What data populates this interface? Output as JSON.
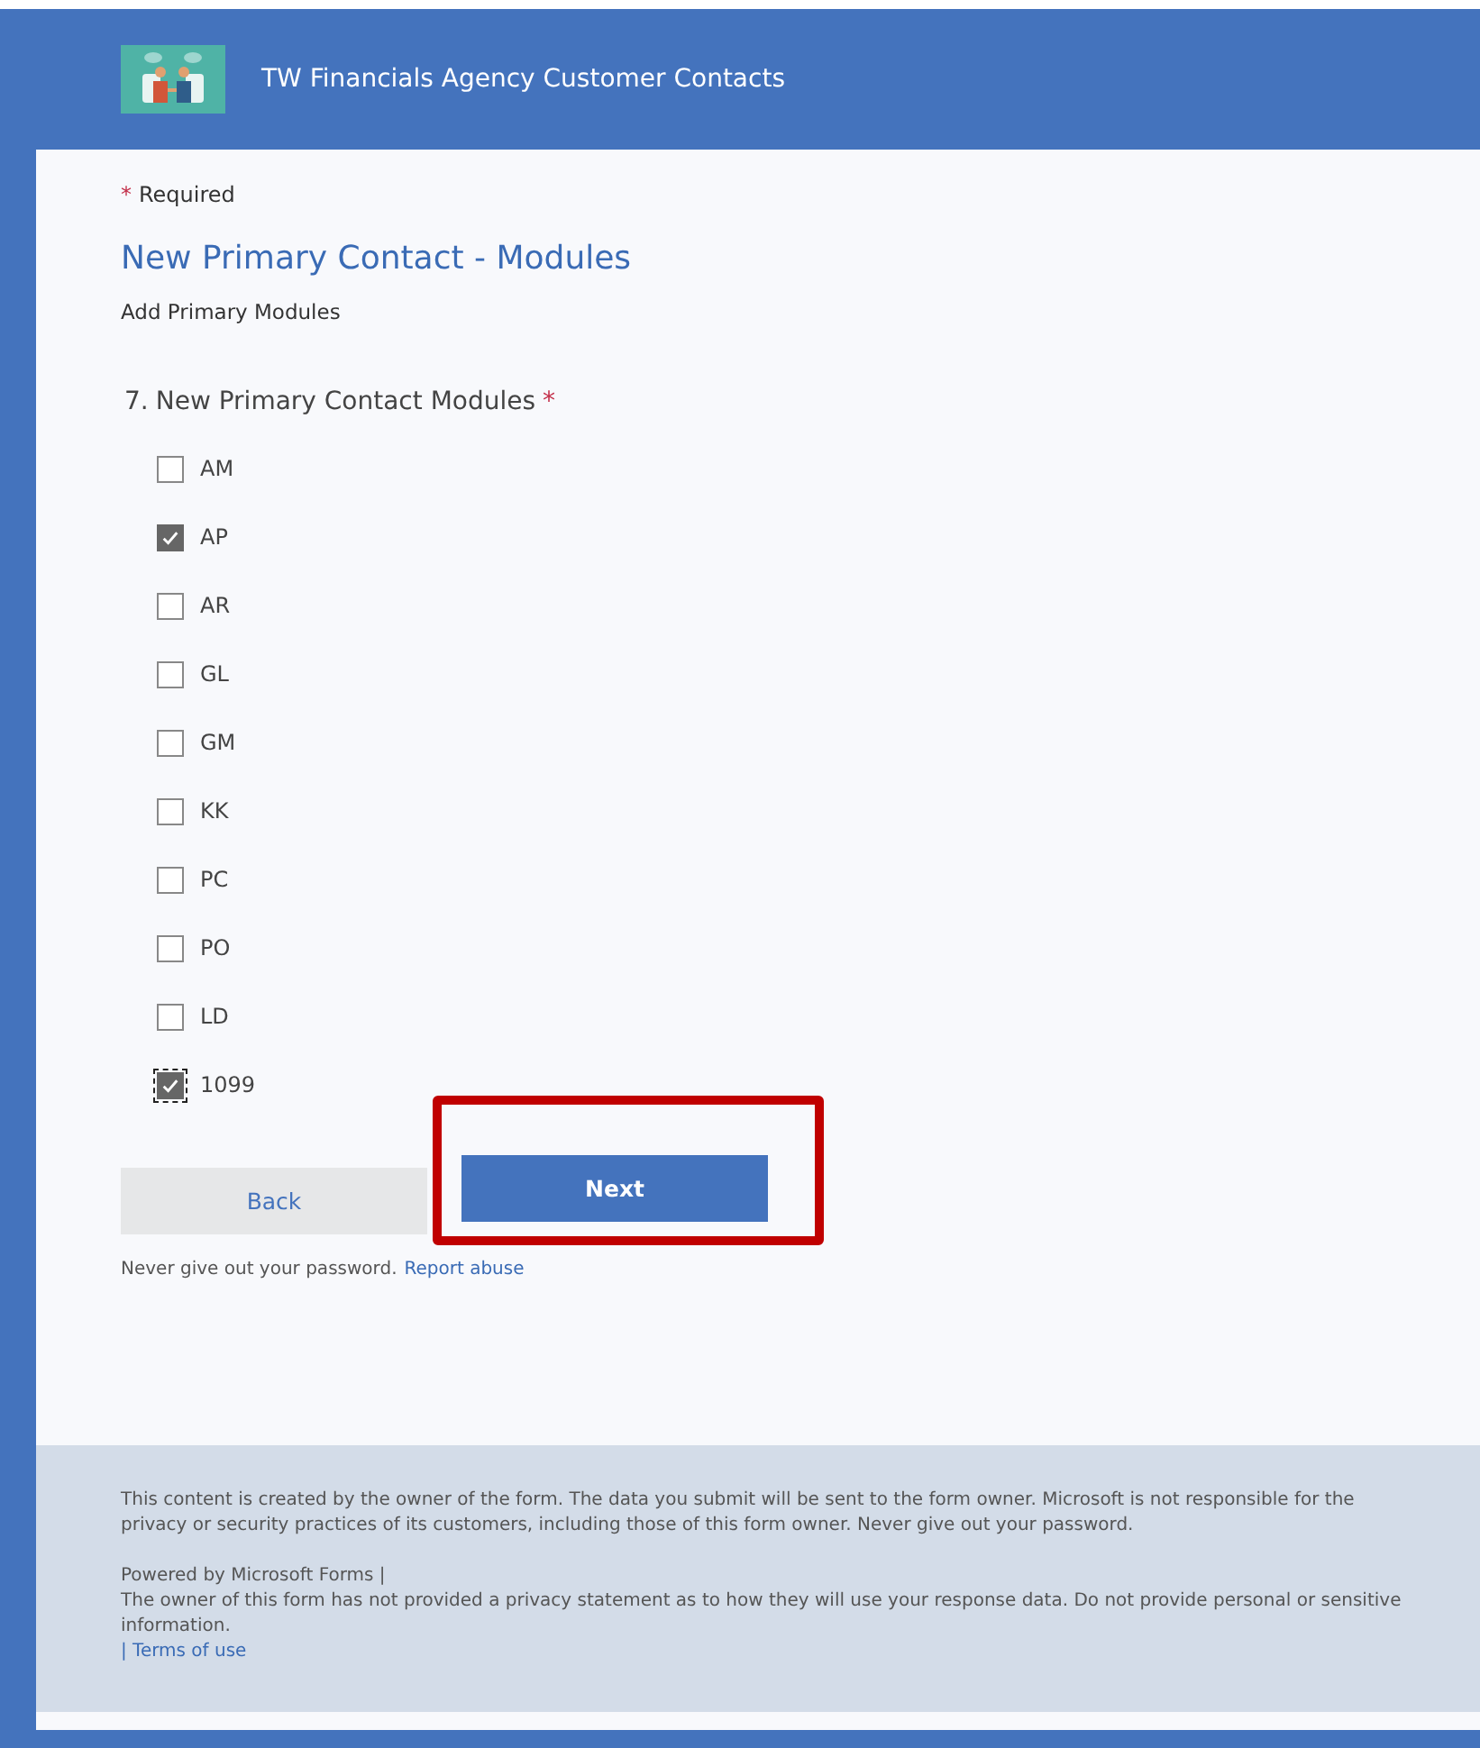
{
  "header": {
    "title": "TW Financials Agency Customer Contacts"
  },
  "required_note": {
    "mark": "*",
    "text": "Required"
  },
  "section": {
    "title": "New Primary Contact - Modules",
    "subtitle": "Add Primary Modules"
  },
  "question": {
    "number": "7.",
    "text": "New Primary Contact Modules",
    "required_mark": "*",
    "options": [
      {
        "label": "AM",
        "checked": false,
        "focused": false
      },
      {
        "label": "AP",
        "checked": true,
        "focused": false
      },
      {
        "label": "AR",
        "checked": false,
        "focused": false
      },
      {
        "label": "GL",
        "checked": false,
        "focused": false
      },
      {
        "label": "GM",
        "checked": false,
        "focused": false
      },
      {
        "label": "KK",
        "checked": false,
        "focused": false
      },
      {
        "label": "PC",
        "checked": false,
        "focused": false
      },
      {
        "label": "PO",
        "checked": false,
        "focused": false
      },
      {
        "label": "LD",
        "checked": false,
        "focused": false
      },
      {
        "label": "1099",
        "checked": true,
        "focused": true
      }
    ]
  },
  "buttons": [
    {
      "label": "Back",
      "kind": "secondary",
      "highlighted": false
    },
    {
      "label": "Next",
      "kind": "primary",
      "highlighted": true
    }
  ],
  "note": {
    "text": "Never give out your password.",
    "link": "Report abuse"
  },
  "footer": {
    "disclaimer": "This content is created by the owner of the form. The data you submit will be sent to the form owner. Microsoft is not responsible for the privacy or security practices of its customers, including those of this form owner. Never give out your password.",
    "powered_by": "Powered by Microsoft Forms |",
    "privacy": "The owner of this form has not provided a privacy statement as to how they will use your response data. Do not provide personal or sensitive information.",
    "terms_link": "| Terms of use"
  }
}
